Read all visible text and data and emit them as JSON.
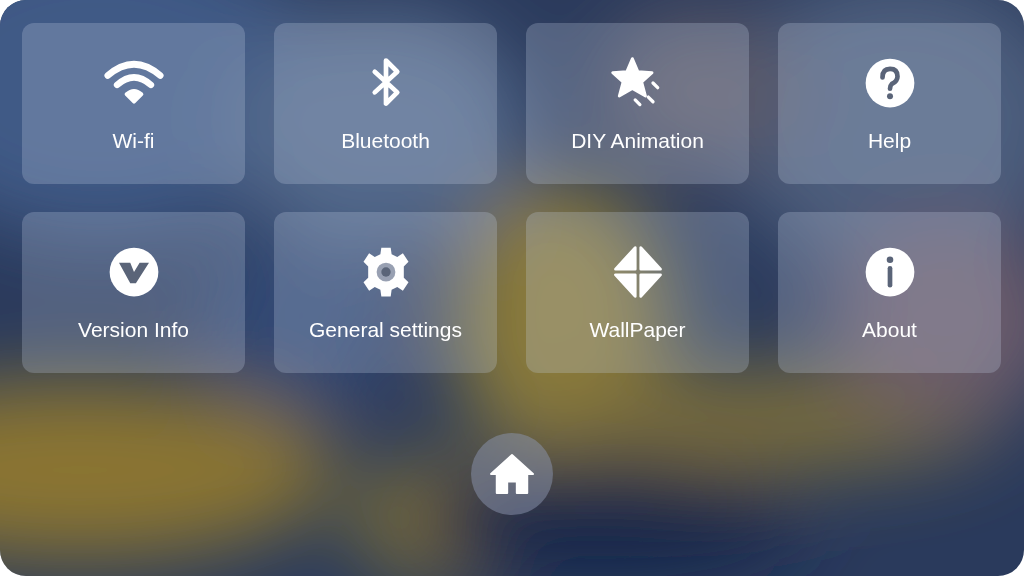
{
  "tiles": [
    {
      "kind": "wifi",
      "label": "Wi-fi"
    },
    {
      "kind": "bluetooth",
      "label": "Bluetooth"
    },
    {
      "kind": "animation",
      "label": "DIY Animation"
    },
    {
      "kind": "help",
      "label": "Help"
    },
    {
      "kind": "version",
      "label": "Version Info"
    },
    {
      "kind": "settings",
      "label": "General settings"
    },
    {
      "kind": "wallpaper",
      "label": "WallPaper"
    },
    {
      "kind": "about",
      "label": "About"
    }
  ]
}
